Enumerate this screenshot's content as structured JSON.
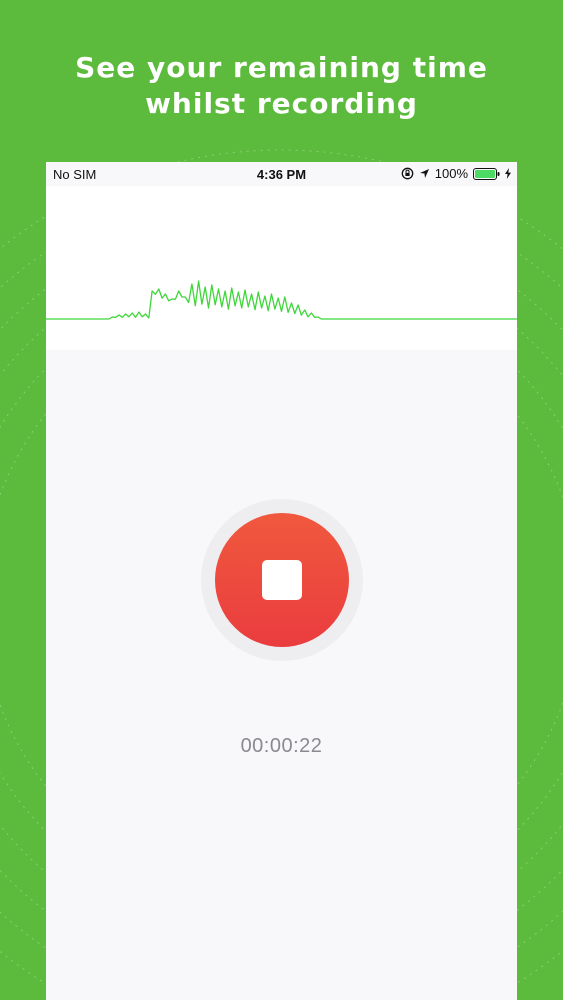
{
  "promo": {
    "headline_line1": "See your remaining time",
    "headline_line2": "whilst recording"
  },
  "statusbar": {
    "carrier": "No SIM",
    "time": "4:36 PM",
    "battery_percent": "100%",
    "icons": [
      "orientation-lock-icon",
      "location-arrow-icon",
      "battery-icon",
      "charging-bolt-icon"
    ]
  },
  "waveform": {
    "color": "#3fd63a"
  },
  "recorder": {
    "stop_icon": "stop-icon",
    "elapsed_time": "00:00:22",
    "button_color": "#ee4a3f"
  },
  "colors": {
    "background": "#5cbb3c",
    "screen": "#f8f7fa"
  }
}
